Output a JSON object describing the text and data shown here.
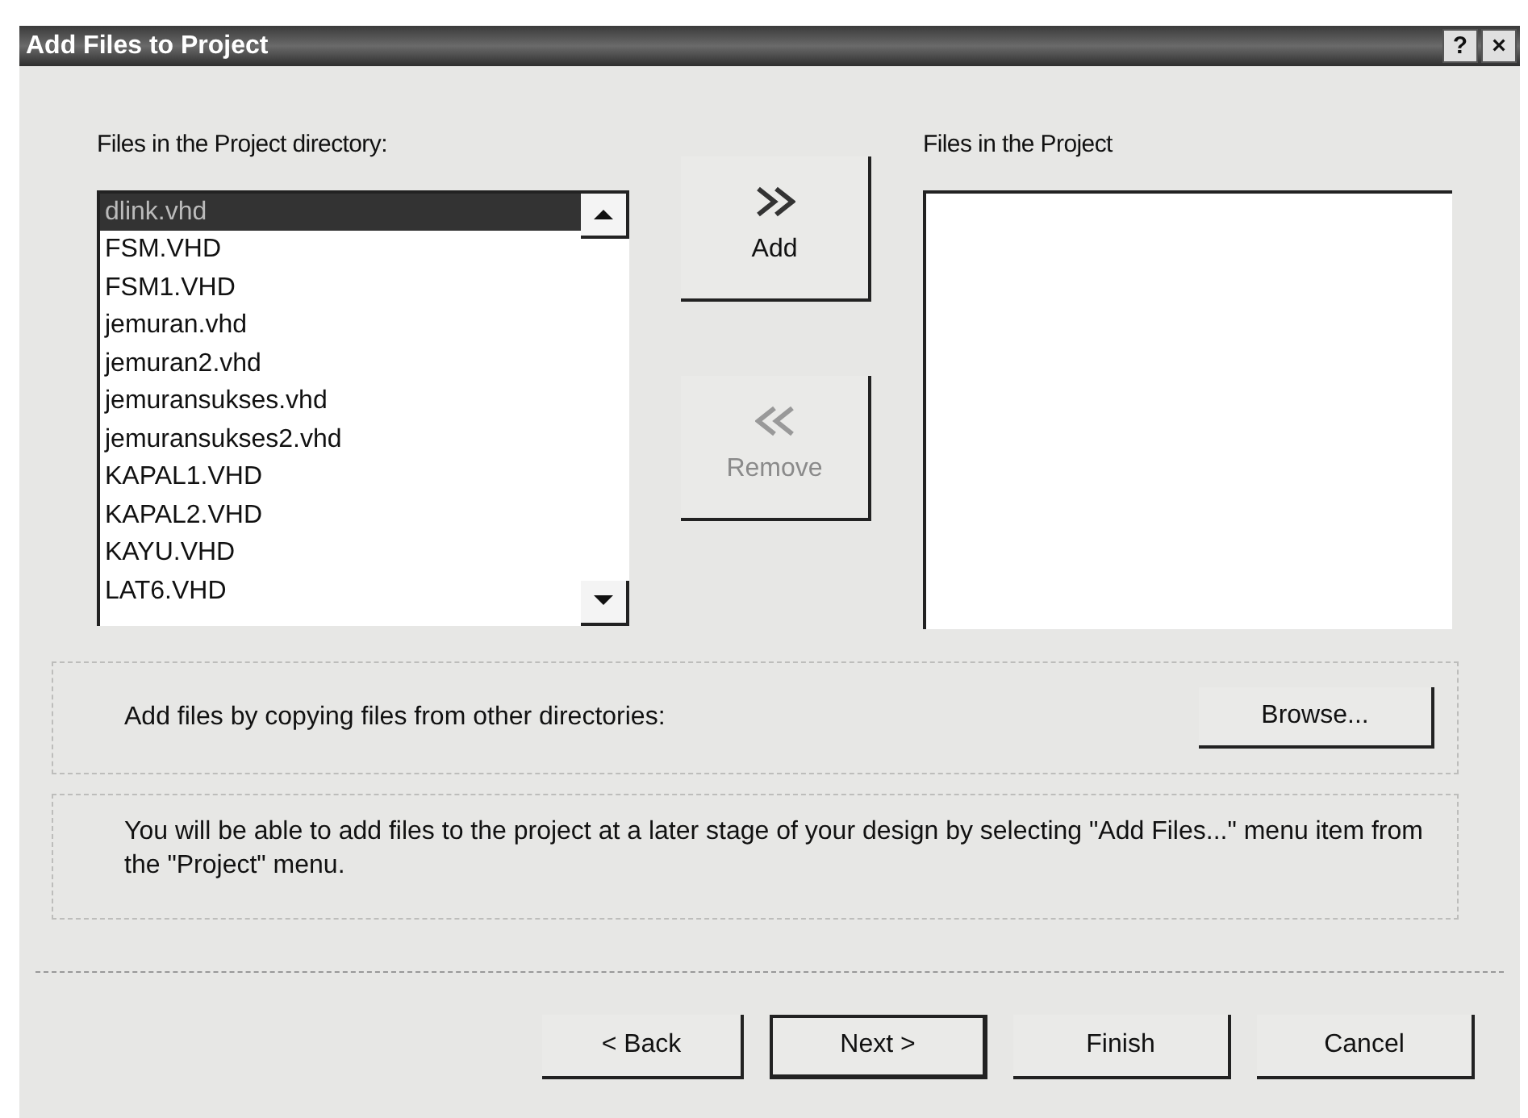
{
  "window": {
    "title": "Add Files to Project",
    "title_buttons": [
      "?",
      "×"
    ]
  },
  "directory_files": {
    "label": "Files in the Project directory:",
    "items": [
      {
        "name": "dlink.vhd",
        "selected": true
      },
      {
        "name": "FSM.VHD",
        "selected": false
      },
      {
        "name": "FSM1.VHD",
        "selected": false
      },
      {
        "name": "jemuran.vhd",
        "selected": false
      },
      {
        "name": "jemuran2.vhd",
        "selected": false
      },
      {
        "name": "jemuransukses.vhd",
        "selected": false
      },
      {
        "name": "jemuransukses2.vhd",
        "selected": false
      },
      {
        "name": "KAPAL1.VHD",
        "selected": false
      },
      {
        "name": "KAPAL2.VHD",
        "selected": false
      },
      {
        "name": "KAYU.VHD",
        "selected": false
      },
      {
        "name": "LAT6.VHD",
        "selected": false
      }
    ]
  },
  "transfer_buttons": [
    {
      "kind": "add",
      "label": "Add",
      "disabled": false
    },
    {
      "kind": "remove",
      "label": "Remove",
      "disabled": true
    }
  ],
  "project_files": {
    "label": "Files in the Project"
  },
  "browse": {
    "text": "Add files by copying files from other directories:",
    "button": "Browse..."
  },
  "note": "You will be able to add files to the project at a later stage of your design by selecting \"Add Files...\" menu item from the \"Project\" menu.",
  "footer_buttons": [
    {
      "label": "< Back",
      "default": false
    },
    {
      "label": "Next >",
      "default": true
    },
    {
      "label": "Finish",
      "default": false
    },
    {
      "label": "Cancel",
      "default": false
    }
  ]
}
